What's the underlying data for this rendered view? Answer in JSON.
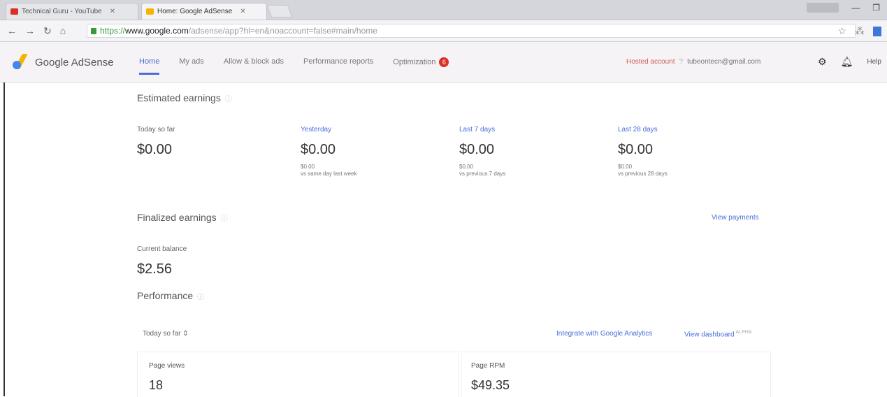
{
  "browser": {
    "tabs": [
      {
        "title": "Technical Guru - YouTube"
      },
      {
        "title": "Home: Google AdSense"
      }
    ],
    "url": {
      "scheme": "https://",
      "host": "www.google.com",
      "path": "/adsense/app?hl=en&noaccount=false#main/home"
    }
  },
  "app": {
    "brand": "Google AdSense",
    "nav": [
      "Home",
      "My ads",
      "Allow & block ads",
      "Performance reports",
      "Optimization"
    ],
    "optimization_badge": "6",
    "hosted_account": "Hosted account",
    "info_mark": "?",
    "email": "tubeontecn@gmail.com",
    "help": "Help"
  },
  "estimated": {
    "title": "Estimated earnings",
    "today": {
      "label": "Today so far",
      "value": "$0.00"
    },
    "yesterday": {
      "label": "Yesterday",
      "value": "$0.00",
      "sub_value": "$0.00",
      "sub_note": "vs same day last week"
    },
    "last7": {
      "label": "Last 7 days",
      "value": "$0.00",
      "sub_value": "$0.00",
      "sub_note": "vs previous 7 days"
    },
    "last28": {
      "label": "Last 28 days",
      "value": "$0.00",
      "sub_value": "$0.00",
      "sub_note": "vs previous 28 days"
    }
  },
  "finalized": {
    "title": "Finalized earnings",
    "view_payments": "View payments",
    "balance_label": "Current balance",
    "balance_value": "$2.56"
  },
  "performance": {
    "title": "Performance",
    "range": "Today so far ⇕",
    "integrate": "Integrate with Google Analytics",
    "view_dashboard": "View dashboard",
    "beta": "ALPHA",
    "page_views_label": "Page views",
    "page_views_value": "18",
    "page_rpm_label": "Page RPM",
    "page_rpm_value": "$49.35"
  },
  "colors": {
    "accent": "#4a6fd8",
    "hosted": "#d0605a",
    "badge": "#d93025"
  }
}
